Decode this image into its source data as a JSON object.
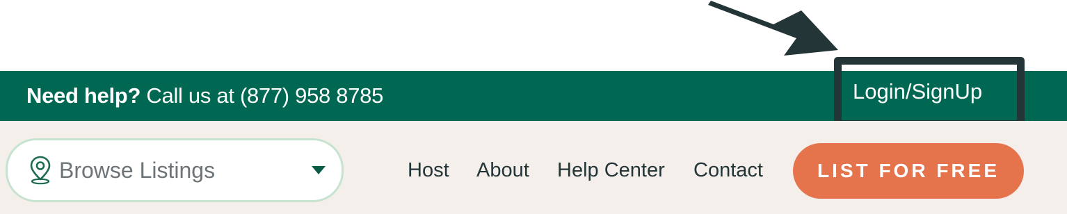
{
  "help_bar": {
    "prefix": "Need help?",
    "text": "Call us at (877) 958 8785",
    "login_label": "Login/SignUp"
  },
  "nav": {
    "browse_label": "Browse Listings",
    "links": [
      "Host",
      "About",
      "Help Center",
      "Contact"
    ],
    "cta_label": "LIST FOR FREE"
  },
  "colors": {
    "brand_green": "#006752",
    "accent_orange": "#e5734c",
    "nav_background": "#f4efeb",
    "annotation": "#243538",
    "pin_icon": "#1e6b52"
  },
  "icons": [
    "map-pin-icon",
    "caret-down-icon",
    "annotation-arrow-icon"
  ]
}
